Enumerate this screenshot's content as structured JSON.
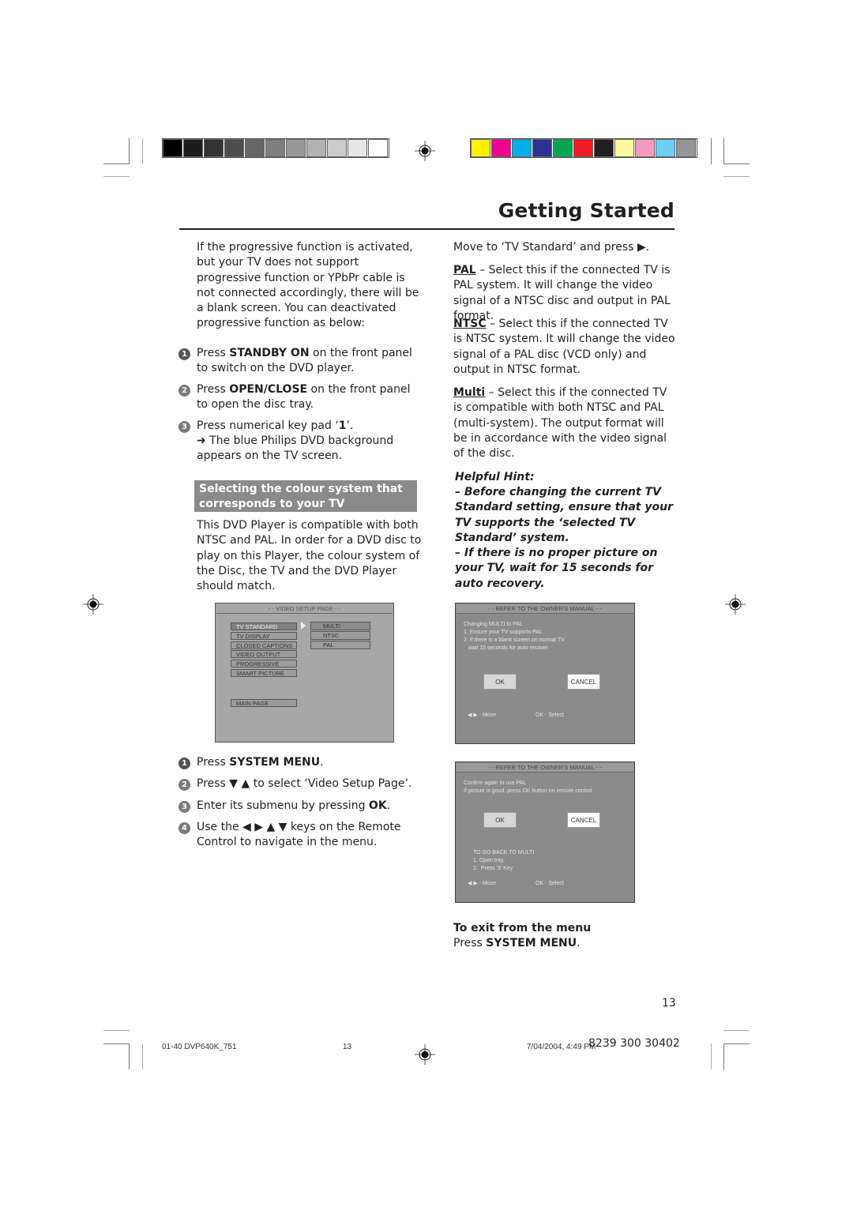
{
  "header": {
    "title": "Getting Started",
    "grayscale_swatches": [
      "#000000",
      "#1c1c1c",
      "#333333",
      "#4d4d4d",
      "#666666",
      "#7f7f7f",
      "#999999",
      "#b2b2b2",
      "#cccccc",
      "#e6e6e6",
      "#ffffff"
    ],
    "color_swatches": [
      "#fff200",
      "#ec008c",
      "#00aeef",
      "#2e3192",
      "#00a651",
      "#ed1c24",
      "#231f20",
      "#fff799",
      "#f49ac1",
      "#6dcff6",
      "#939598"
    ]
  },
  "left": {
    "intro": "If the progressive function is activated, but your TV does not support progressive function or YPbPr cable is not connected accordingly, there will be a blank screen. You can deactivated progressive function as below:",
    "steps_a": [
      {
        "n": "1",
        "pre": "Press ",
        "bold": "STANDBY ON",
        "post": " on the front panel to switch on the DVD player."
      },
      {
        "n": "2",
        "pre": "Press ",
        "bold": "OPEN/CLOSE",
        "post": " on the front panel to open the disc tray."
      },
      {
        "n": "3",
        "pre": "Press numerical key pad ‘",
        "bold": "1",
        "post": "’."
      }
    ],
    "step3_result": "➜ The blue Philips DVD background appears on the TV screen.",
    "section_heading": "Selecting the colour system that corresponds to your TV",
    "section_body": "This DVD Player is compatible with both NTSC and PAL. In order for a DVD disc to play on this Player, the colour system of the Disc, the TV and the DVD Player should match.",
    "steps_b": [
      {
        "n": "1",
        "pre": "Press ",
        "bold": "SYSTEM MENU",
        "post": "."
      },
      {
        "n": "2",
        "pre": "Press ▼ ▲ to select ‘Video Setup Page’.",
        "bold": "",
        "post": ""
      },
      {
        "n": "3",
        "pre": "Enter its submenu by pressing ",
        "bold": "OK",
        "post": "."
      },
      {
        "n": "4",
        "pre": "Use the ◀ ▶ ▲ ▼ keys on the Remote Control to navigate in the menu.",
        "bold": "",
        "post": ""
      }
    ]
  },
  "osd_setup": {
    "header": "- - VIDEO SETUP PAGE - -",
    "menu": [
      "TV STANDARD",
      "TV DISPLAY",
      "CLOSED CAPTIONS",
      "VIDEO OUTPUT",
      "PROGRESSIVE",
      "SMART PICTURE"
    ],
    "submenu": [
      "MULTI",
      "NTSC",
      "PAL"
    ],
    "main_page": "MAIN PAGE"
  },
  "right": {
    "move_text": "Move to ‘TV Standard’ and press ▶.",
    "options": [
      {
        "name": "PAL",
        "desc": " – Select this if the connected TV is PAL system. It will change the video signal of a NTSC disc and output in PAL format."
      },
      {
        "name": "NTSC",
        "desc": " – Select this if the connected TV is NTSC system. It will change the video signal of a PAL disc (VCD only) and output in NTSC format."
      },
      {
        "name": "Multi",
        "desc": " – Select this if the connected TV is compatible with both NTSC and PAL (multi-system). The output format will be in accordance with the video signal of the disc."
      }
    ],
    "hint_title": "Helpful Hint:",
    "hints": [
      "–    Before changing the current TV Standard setting, ensure that your TV supports the ‘selected TV Standard’ system.",
      "–    If there is no proper picture on your TV, wait for 15 seconds for auto recovery."
    ],
    "exit_title": "To exit from the menu",
    "exit_pre": "Press ",
    "exit_bold": "SYSTEM MENU",
    "exit_post": "."
  },
  "osd_confirm1": {
    "header": "- - REFER TO THE OWNER'S MANUAL - -",
    "lines": [
      "Changing MULTI to PAL",
      "1. Ensure your TV supports PAL",
      "2. If there is a blank screen on normal TV",
      "   wait 15 seconds for auto recover"
    ],
    "ok": "OK",
    "cancel": "CANCEL",
    "move": "◀ ▶  - Move",
    "select": "OK - Select"
  },
  "osd_confirm2": {
    "header": "- - REFER TO THE OWNER'S MANUAL - -",
    "lines": [
      "Confirm again to use PAL",
      "If picture is good, press OK button on remote control"
    ],
    "ok": "OK",
    "cancel": "CANCEL",
    "back_lines": [
      "TO GO BACK TO MULTI",
      "1. Open tray,",
      "2.  Press '3' Key"
    ],
    "move": "◀ ▶  - Move",
    "select": "OK - Select"
  },
  "footer": {
    "page_number": "13",
    "file": "01-40 DVP640K_751",
    "sheet": "13",
    "date": "7/04/2004, 4:49 PM",
    "code": "8239 300 30402"
  }
}
